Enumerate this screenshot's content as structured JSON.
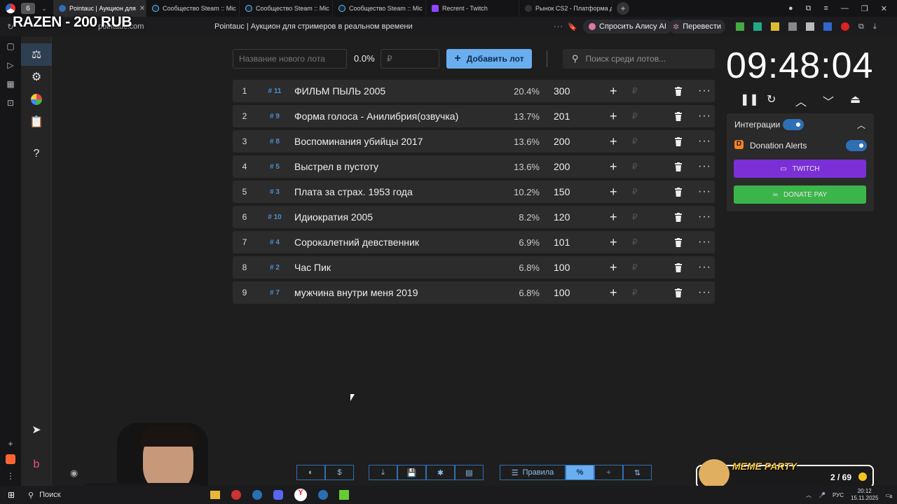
{
  "browser": {
    "tab_count": "6",
    "tabs": [
      {
        "label": "Pointauc | Аукцион для",
        "active": true
      },
      {
        "label": "Сообщество Steam :: Mic"
      },
      {
        "label": "Сообщество Steam :: Mic"
      },
      {
        "label": "Сообщество Steam :: Mic"
      },
      {
        "label": "Recrent - Twitch"
      },
      {
        "label": "Рынок CS2 - Платформа д"
      }
    ],
    "address": "pointauc.com",
    "page_title": "Pointauc | Аукцион для стримеров в реальном времени",
    "alice": "Спросить Алису AI",
    "translate": "Перевести"
  },
  "overlay": {
    "title": "RAZEN - 200 RUB"
  },
  "toolbar": {
    "new_lot_placeholder": "Название нового лота",
    "percent": "0.0%",
    "amount_placeholder": "₽",
    "add_label": "Добавить лот",
    "search_placeholder": "Поиск среди лотов..."
  },
  "lots": [
    {
      "num": "1",
      "id": "# 11",
      "title": "ФИЛЬМ ПЫЛЬ 2005",
      "pct": "20.4%",
      "amount": "300"
    },
    {
      "num": "2",
      "id": "# 9",
      "title": "Форма голоса - Анилибрия(озвучка)",
      "pct": "13.7%",
      "amount": "201"
    },
    {
      "num": "3",
      "id": "# 8",
      "title": "Воспоминания убийцы 2017",
      "pct": "13.6%",
      "amount": "200"
    },
    {
      "num": "4",
      "id": "# 5",
      "title": "Выстрел в пустоту",
      "pct": "13.6%",
      "amount": "200"
    },
    {
      "num": "5",
      "id": "# 3",
      "title": "Плата за страх. 1953 года",
      "pct": "10.2%",
      "amount": "150"
    },
    {
      "num": "6",
      "id": "# 10",
      "title": "Идиократия 2005",
      "pct": "8.2%",
      "amount": "120"
    },
    {
      "num": "7",
      "id": "# 4",
      "title": "Сорокалетний девственник",
      "pct": "6.9%",
      "amount": "101"
    },
    {
      "num": "8",
      "id": "# 2",
      "title": "Час Пик",
      "pct": "6.8%",
      "amount": "100"
    },
    {
      "num": "9",
      "id": "# 7",
      "title": "мужчина внутри меня 2019",
      "pct": "6.8%",
      "amount": "100"
    }
  ],
  "lot_actions": {
    "plus": "+",
    "rub": "₽",
    "more": "···"
  },
  "timer": {
    "value": "09:48:04"
  },
  "integrations": {
    "label": "Интеграции",
    "donation_alerts": "Donation Alerts",
    "twitch": "TWITCH",
    "donatepay": "DONATE PAY"
  },
  "bottom": {
    "rules": "Правила",
    "percent": "%",
    "dollar": "$"
  },
  "meme_party": {
    "title": "MEME PARTY",
    "count": "2 / 69"
  },
  "taskbar": {
    "search": "Поиск",
    "lang": "РУС",
    "time": "20:12",
    "date": "15.11.2025",
    "notif": "4"
  },
  "colors": {
    "accent": "#6aaef0",
    "twitch": "#7b2fd6",
    "donatepay": "#3bb54a",
    "bg": "#1e1e1e",
    "row": "#2c2c2c"
  }
}
